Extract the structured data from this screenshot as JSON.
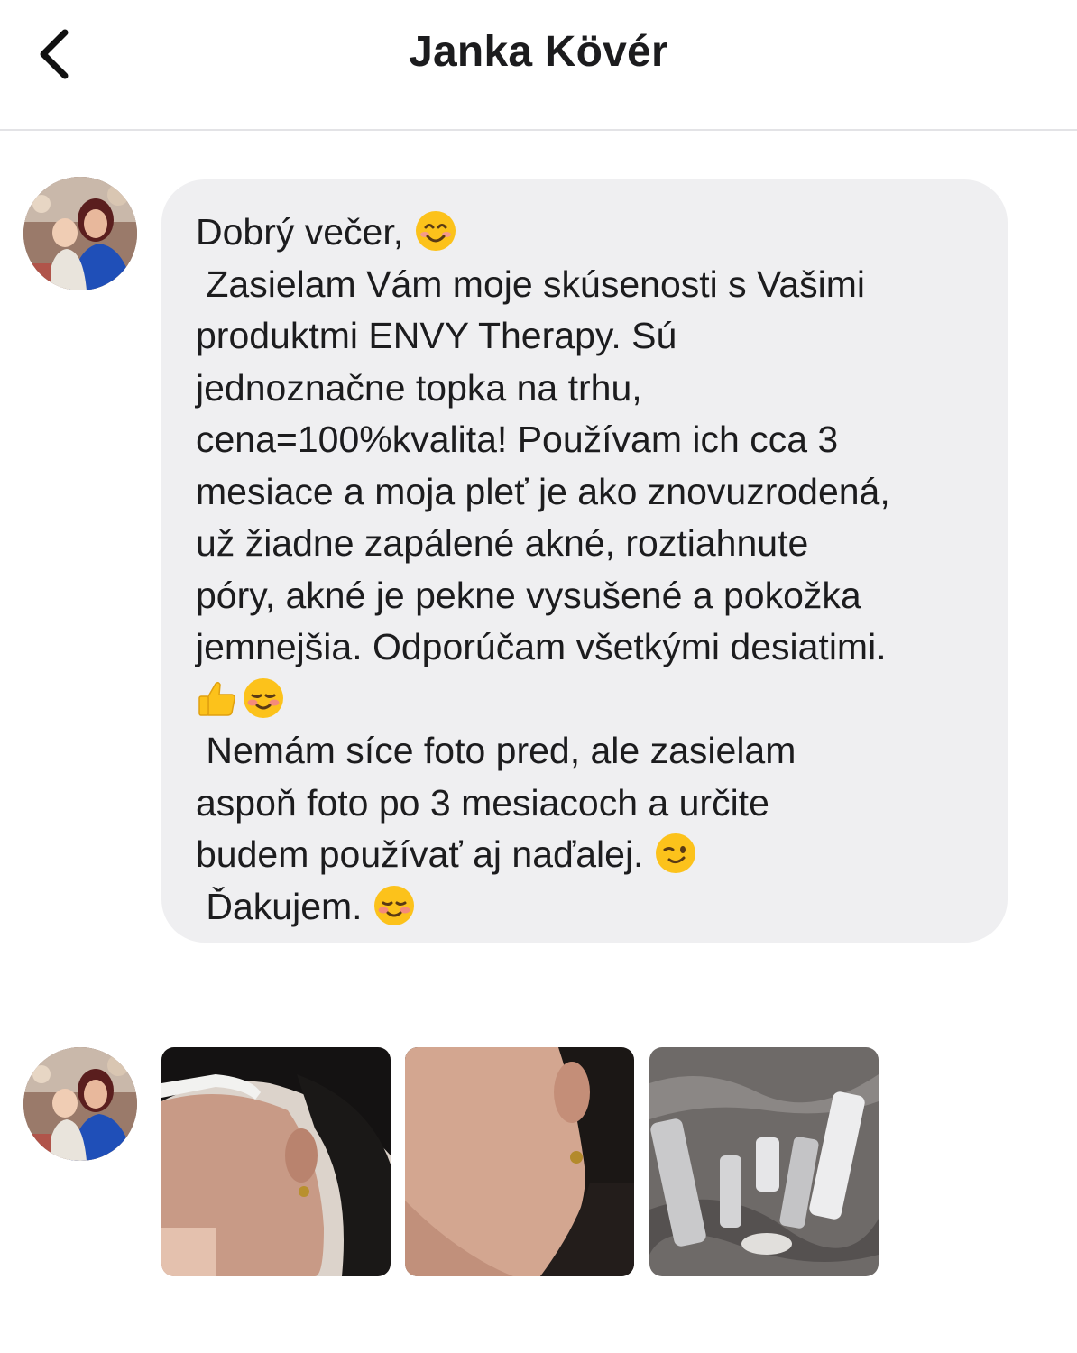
{
  "header": {
    "back_icon": "chevron-left-icon",
    "title": "Janka Kövér"
  },
  "message": {
    "lines": [
      {
        "text": "Dobrý večer, ",
        "emojis": [
          "smiling-face-icon"
        ]
      },
      {
        "text": " Zasielam Vám moje skúsenosti s Vašimi",
        "emojis": []
      },
      {
        "text": "produktmi ENVY Therapy. Sú",
        "emojis": []
      },
      {
        "text": "jednoznačne topka na trhu,",
        "emojis": []
      },
      {
        "text": "cena=100%kvalita! Používam ich cca 3",
        "emojis": []
      },
      {
        "text": "mesiace a moja pleť je ako znovuzrodená,",
        "emojis": []
      },
      {
        "text": "už žiadne zapálené akné, roztiahnute",
        "emojis": []
      },
      {
        "text": "póry, akné je pekne vysušené a pokožka",
        "emojis": []
      },
      {
        "text": "jemnejšia. Odporúčam všetkými desiatimi.",
        "emojis": []
      },
      {
        "text": "",
        "emojis": [
          "thumbs-up-icon",
          "blushing-face-icon"
        ]
      },
      {
        "text": " Nemám síce foto pred, ale zasielam",
        "emojis": []
      },
      {
        "text": "aspoň foto po 3 mesiacoch a určite",
        "emojis": []
      },
      {
        "text": "budem používať aj naďalej. ",
        "emojis": [
          "winking-face-icon"
        ]
      },
      {
        "text": " Ďakujem. ",
        "emojis": [
          "blushing-face-icon"
        ]
      }
    ]
  },
  "attachments": [
    {
      "icon": "face-profile-photo"
    },
    {
      "icon": "skin-closeup-photo"
    },
    {
      "icon": "products-photo"
    }
  ],
  "colors": {
    "bubble": "#efeff1",
    "text": "#1c1c1e",
    "divider": "#e3e3e6"
  }
}
